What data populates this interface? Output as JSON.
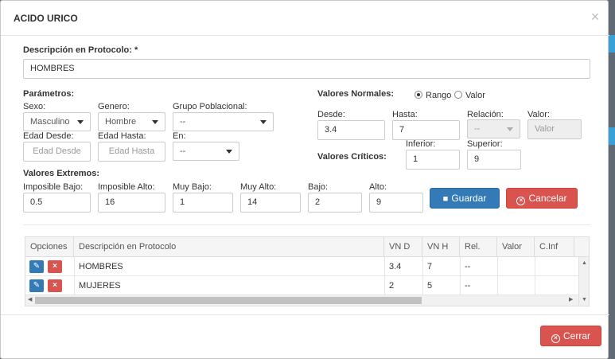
{
  "modal": {
    "title": "ACIDO URICO",
    "close_symbol": "×"
  },
  "descripcion": {
    "label": "Descripción en Protocolo: *",
    "value": "HOMBRES"
  },
  "parametros": {
    "label": "Parámetros:",
    "sexo": {
      "label": "Sexo:",
      "value": "Masculino"
    },
    "genero": {
      "label": "Genero:",
      "value": "Hombre"
    },
    "grupo": {
      "label": "Grupo Poblacional:",
      "value": "--"
    },
    "edad_desde": {
      "label": "Edad Desde:",
      "placeholder": "Edad Desde"
    },
    "edad_hasta": {
      "label": "Edad Hasta:",
      "placeholder": "Edad Hasta"
    },
    "en": {
      "label": "En:",
      "value": "--"
    }
  },
  "valores_normales": {
    "label": "Valores Normales:",
    "rango_label": "Rango",
    "valor_label": "Valor",
    "selected": "Rango",
    "desde": {
      "label": "Desde:",
      "value": "3.4"
    },
    "hasta": {
      "label": "Hasta:",
      "value": "7"
    },
    "relacion": {
      "label": "Relación:",
      "value": "--"
    },
    "valor": {
      "label": "Valor:",
      "placeholder": "Valor"
    }
  },
  "valores_criticos": {
    "label": "Valores Críticos:",
    "inferior": {
      "label": "Inferior:",
      "value": "1"
    },
    "superior": {
      "label": "Superior:",
      "value": "9"
    }
  },
  "valores_extremos": {
    "label": "Valores Extremos:",
    "imposible_bajo": {
      "label": "Imposible Bajo:",
      "value": "0.5"
    },
    "imposible_alto": {
      "label": "Imposible Alto:",
      "value": "16"
    },
    "muy_bajo": {
      "label": "Muy Bajo:",
      "value": "1"
    },
    "muy_alto": {
      "label": "Muy Alto:",
      "value": "14"
    },
    "bajo": {
      "label": "Bajo:",
      "value": "2"
    },
    "alto": {
      "label": "Alto:",
      "value": "9"
    }
  },
  "buttons": {
    "guardar": "Guardar",
    "cancelar": "Cancelar",
    "cerrar": "Cerrar"
  },
  "table": {
    "columns": [
      "Opciones",
      "Descripción en Protocolo",
      "VN D",
      "VN H",
      "Rel.",
      "Valor",
      "C.Inf"
    ],
    "rows": [
      {
        "descripcion": "HOMBRES",
        "vn_d": "3.4",
        "vn_h": "7",
        "rel": "--",
        "valor": "",
        "c_inf": ""
      },
      {
        "descripcion": "MUJERES",
        "vn_d": "2",
        "vn_h": "5",
        "rel": "--",
        "valor": "",
        "c_inf": ""
      }
    ]
  },
  "colors": {
    "primary": "#337ab7",
    "danger": "#d9534f"
  }
}
